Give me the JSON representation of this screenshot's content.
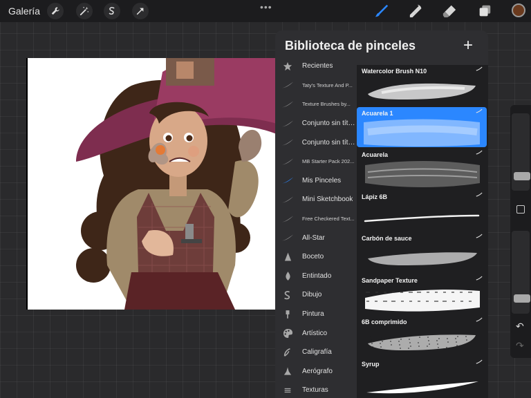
{
  "topbar": {
    "gallery_label": "Galería",
    "action_icons": [
      "wrench-icon",
      "magic-wand-icon",
      "selection-icon",
      "transform-arrow-icon"
    ],
    "more_label": "•••",
    "tool_icons": [
      "brush-icon",
      "smudge-icon",
      "eraser-icon",
      "layers-icon"
    ],
    "active_tool_color": "#2b87ff",
    "current_color": "#6a3a1e"
  },
  "library": {
    "title": "Biblioteca de pinceles",
    "add_label": "+",
    "groups": [
      {
        "label": "Recientes",
        "icon": "star-icon",
        "small": false
      },
      {
        "label": "Taty's Texture And P...",
        "icon": "brush-stroke-icon",
        "small": true
      },
      {
        "label": "Texture Brushes by...",
        "icon": "brush-stroke-icon",
        "small": true
      },
      {
        "label": "Conjunto sin título",
        "icon": "brush-stroke-icon",
        "small": false
      },
      {
        "label": "Conjunto sin título",
        "icon": "brush-stroke-icon",
        "small": false
      },
      {
        "label": "MB Starter Pack 202...",
        "icon": "brush-stroke-icon",
        "small": true
      },
      {
        "label": "Mis Pinceles",
        "icon": "brush-stroke-icon",
        "small": false,
        "selected": true
      },
      {
        "label": "Mini Sketchbook",
        "icon": "brush-stroke-icon",
        "small": false
      },
      {
        "label": "Free Checkered Text...",
        "icon": "brush-stroke-icon",
        "small": true
      },
      {
        "label": "All-Star",
        "icon": "brush-stroke-icon",
        "small": false
      },
      {
        "label": "Boceto",
        "icon": "pencil-tip-icon",
        "small": false
      },
      {
        "label": "Entintado",
        "icon": "ink-drop-icon",
        "small": false
      },
      {
        "label": "Dibujo",
        "icon": "swirl-icon",
        "small": false
      },
      {
        "label": "Pintura",
        "icon": "paint-brush-icon",
        "small": false
      },
      {
        "label": "Artístico",
        "icon": "palette-icon",
        "small": false
      },
      {
        "label": "Caligrafía",
        "icon": "calligraphy-icon",
        "small": false
      },
      {
        "label": "Aerógrafo",
        "icon": "airbrush-icon",
        "small": false
      },
      {
        "label": "Texturas",
        "icon": "texture-icon",
        "small": false
      }
    ],
    "brushes": [
      {
        "name": "Watercolor Brush N10",
        "style": "watercolor",
        "selected": false
      },
      {
        "name": "Acuarela 1",
        "style": "blue-wash",
        "selected": true
      },
      {
        "name": "Acuarela",
        "style": "gray-wash",
        "selected": false
      },
      {
        "name": "Lápiz 6B",
        "style": "pencil",
        "selected": false
      },
      {
        "name": "Carbón de sauce",
        "style": "charcoal",
        "selected": false
      },
      {
        "name": "Sandpaper Texture",
        "style": "sandpaper",
        "selected": false
      },
      {
        "name": "6B comprimido",
        "style": "compressed",
        "selected": false
      },
      {
        "name": "Syrup",
        "style": "syrup",
        "selected": false
      }
    ],
    "accent_color": "#2b87ff"
  },
  "sidebar": {
    "undo_label": "↶",
    "redo_label": "↷",
    "size_level": 0.15,
    "opacity_level": 0.15
  }
}
